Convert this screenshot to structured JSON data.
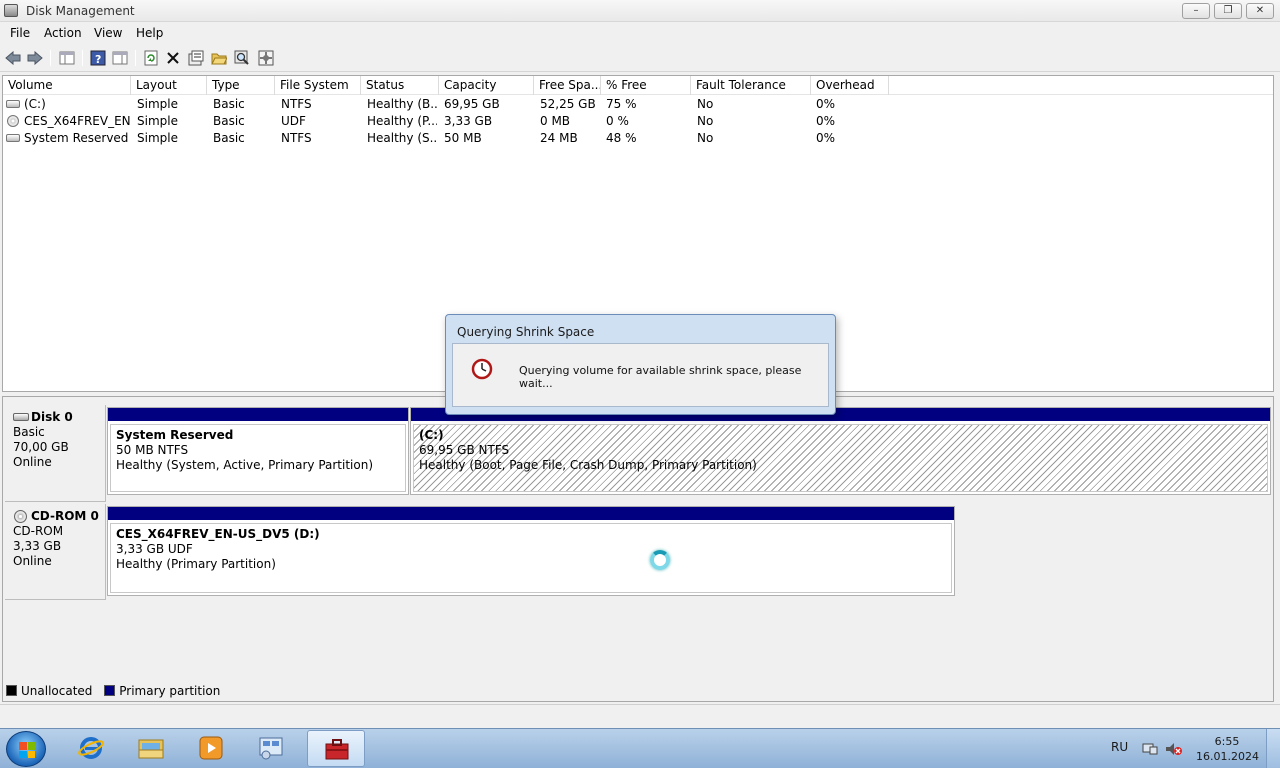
{
  "window": {
    "title": "Disk Management"
  },
  "menu": [
    "File",
    "Action",
    "View",
    "Help"
  ],
  "toolbar": [
    "back-icon",
    "forward-icon",
    "console-tree-icon",
    "help-icon",
    "properties-pane-icon",
    "refresh-icon",
    "delete-icon",
    "properties-icon",
    "open-icon",
    "explore-icon",
    "settings-icon"
  ],
  "volumes": {
    "columns": [
      "Volume",
      "Layout",
      "Type",
      "File System",
      "Status",
      "Capacity",
      "Free Spa...",
      "% Free",
      "Fault Tolerance",
      "Overhead"
    ],
    "rows": [
      {
        "volume": "(C:)",
        "layout": "Simple",
        "type": "Basic",
        "fs": "NTFS",
        "status": "Healthy (B...",
        "capacity": "69,95 GB",
        "free": "52,25 GB",
        "pct": "75 %",
        "fault": "No",
        "overhead": "0%",
        "icon": "drive"
      },
      {
        "volume": "CES_X64FREV_EN-...",
        "layout": "Simple",
        "type": "Basic",
        "fs": "UDF",
        "status": "Healthy (P...",
        "capacity": "3,33 GB",
        "free": "0 MB",
        "pct": "0 %",
        "fault": "No",
        "overhead": "0%",
        "icon": "cd"
      },
      {
        "volume": "System Reserved",
        "layout": "Simple",
        "type": "Basic",
        "fs": "NTFS",
        "status": "Healthy (S...",
        "capacity": "50 MB",
        "free": "24 MB",
        "pct": "48 %",
        "fault": "No",
        "overhead": "0%",
        "icon": "drive"
      }
    ]
  },
  "disks": [
    {
      "name": "Disk 0",
      "kind": "Basic",
      "size": "70,00 GB",
      "state": "Online",
      "partitions": [
        {
          "name": "System Reserved",
          "size": "50 MB NTFS",
          "status": "Healthy (System, Active, Primary Partition)"
        },
        {
          "name": "(C:)",
          "size": "69,95 GB NTFS",
          "status": "Healthy (Boot, Page File, Crash Dump, Primary Partition)"
        }
      ]
    },
    {
      "name": "CD-ROM 0",
      "kind": "CD-ROM",
      "size": "3,33 GB",
      "state": "Online",
      "partitions": [
        {
          "name": "CES_X64FREV_EN-US_DV5  (D:)",
          "size": "3,33 GB UDF",
          "status": "Healthy (Primary Partition)"
        }
      ]
    }
  ],
  "legend": {
    "unallocated": "Unallocated",
    "primary": "Primary partition",
    "unallocated_color": "#000000",
    "primary_color": "#000080"
  },
  "dialog": {
    "title": "Querying Shrink Space",
    "message": "Querying volume for available shrink space, please wait..."
  },
  "taskbar": {
    "items": [
      "start-button",
      "internet-explorer",
      "windows-explorer",
      "media-player",
      "control-panel",
      "disk-management"
    ],
    "language": "RU",
    "time": "6:55",
    "date": "16.01.2024"
  }
}
